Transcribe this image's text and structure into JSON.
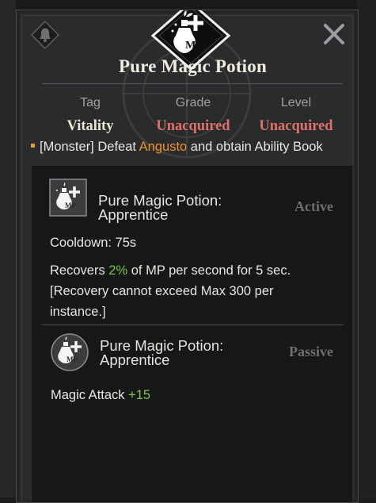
{
  "title": "Pure Magic Potion",
  "emblem_label": "MP",
  "colors": {
    "vitality": "#ece6d0",
    "unacquired": "#e0706a",
    "highlight": "#f0902c",
    "positive": "#7ec24a"
  },
  "icons": {
    "bell": "bell-icon",
    "close": "close-icon",
    "potion": "potion-icon"
  },
  "info": {
    "headers": {
      "tag": "Tag",
      "grade": "Grade",
      "level": "Level"
    },
    "values": {
      "tag": "Vitality",
      "grade": "Unacquired",
      "level": "Unacquired"
    }
  },
  "source": {
    "prefix": "[Monster] Defeat ",
    "monster": "Angusto",
    "suffix": " and obtain Ability Book"
  },
  "skills": [
    {
      "name_line1": "Pure Magic Potion:",
      "name_line2": "Apprentice",
      "type": "Active",
      "cooldown": "Cooldown: 75s",
      "desc_prefix": "Recovers ",
      "desc_value": "2%",
      "desc_suffix": " of MP per second for 5 sec.",
      "desc_line2": "[Recovery cannot exceed Max 300 per",
      "desc_line3": "instance.]"
    },
    {
      "name_line1": "Pure Magic Potion:",
      "name_line2": "Apprentice",
      "type": "Passive",
      "stat_label": "Magic Attack ",
      "stat_value": "+15"
    }
  ]
}
